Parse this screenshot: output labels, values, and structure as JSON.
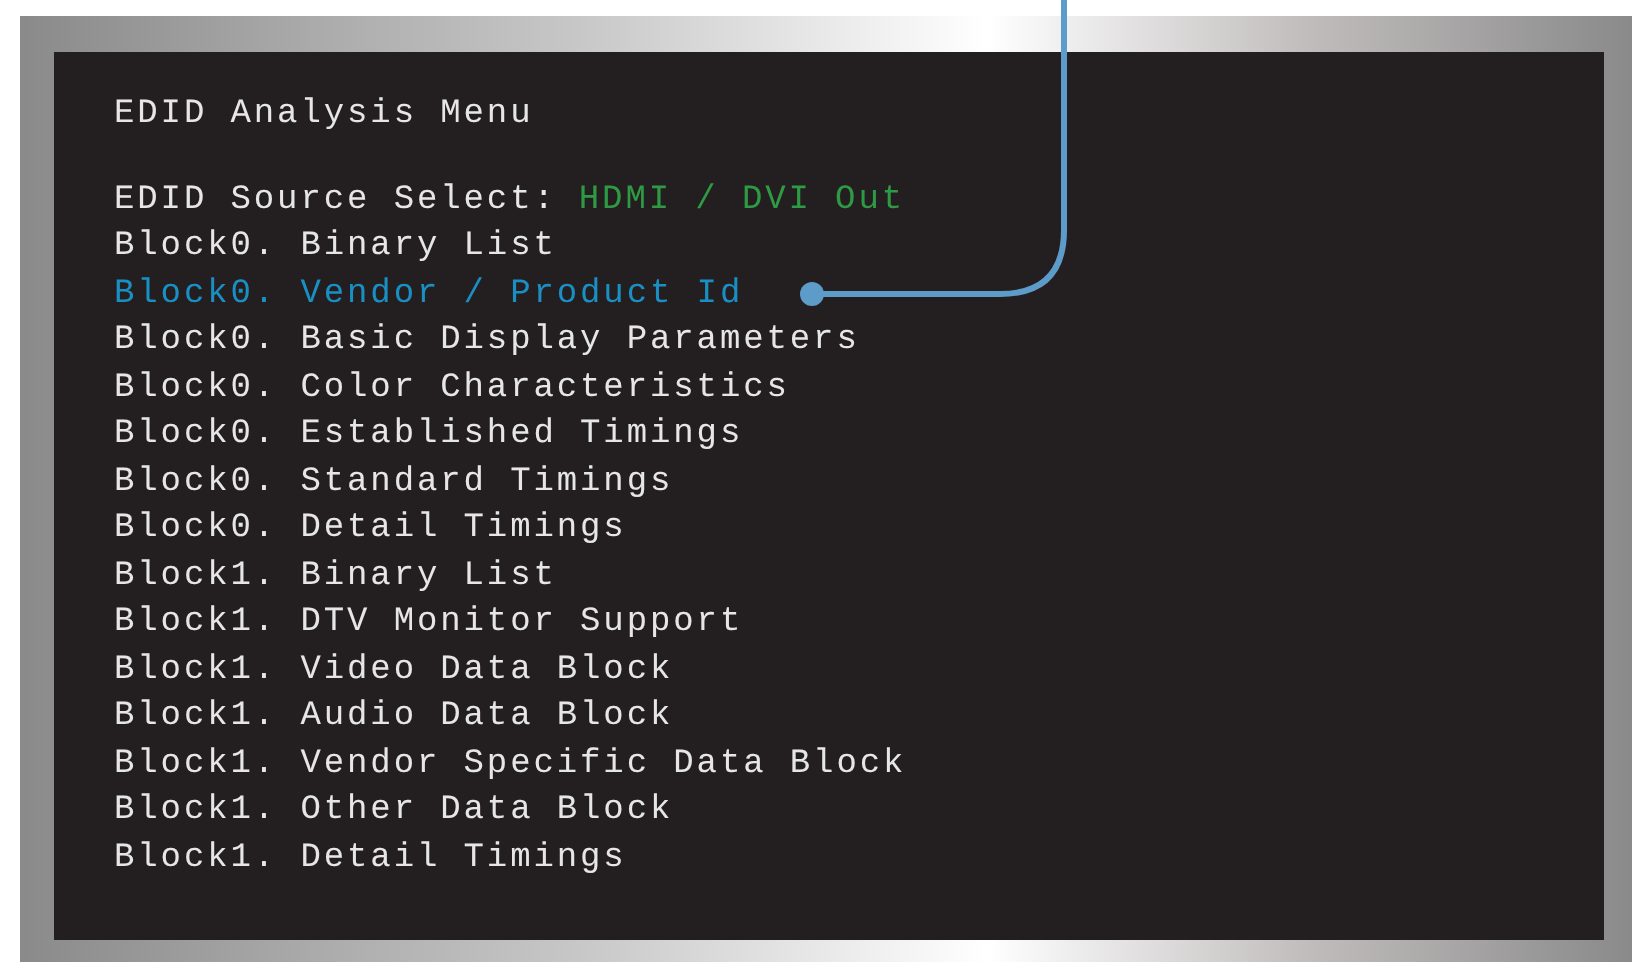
{
  "title": "EDID Analysis Menu",
  "source_select": {
    "label": "EDID Source Select:",
    "value": "HDMI / DVI Out"
  },
  "menu_items": [
    {
      "label": "Block0. Binary List",
      "selected": false
    },
    {
      "label": "Block0. Vendor / Product Id",
      "selected": true
    },
    {
      "label": "Block0. Basic Display Parameters",
      "selected": false
    },
    {
      "label": "Block0. Color Characteristics",
      "selected": false
    },
    {
      "label": "Block0. Established Timings",
      "selected": false
    },
    {
      "label": "Block0. Standard Timings",
      "selected": false
    },
    {
      "label": "Block0. Detail Timings",
      "selected": false
    },
    {
      "label": "Block1. Binary List",
      "selected": false
    },
    {
      "label": "Block1. DTV Monitor Support",
      "selected": false
    },
    {
      "label": "Block1. Video Data Block",
      "selected": false
    },
    {
      "label": "Block1. Audio Data Block",
      "selected": false
    },
    {
      "label": "Block1. Vendor Specific Data Block",
      "selected": false
    },
    {
      "label": "Block1. Other Data Block",
      "selected": false
    },
    {
      "label": "Block1. Detail Timings",
      "selected": false
    }
  ]
}
